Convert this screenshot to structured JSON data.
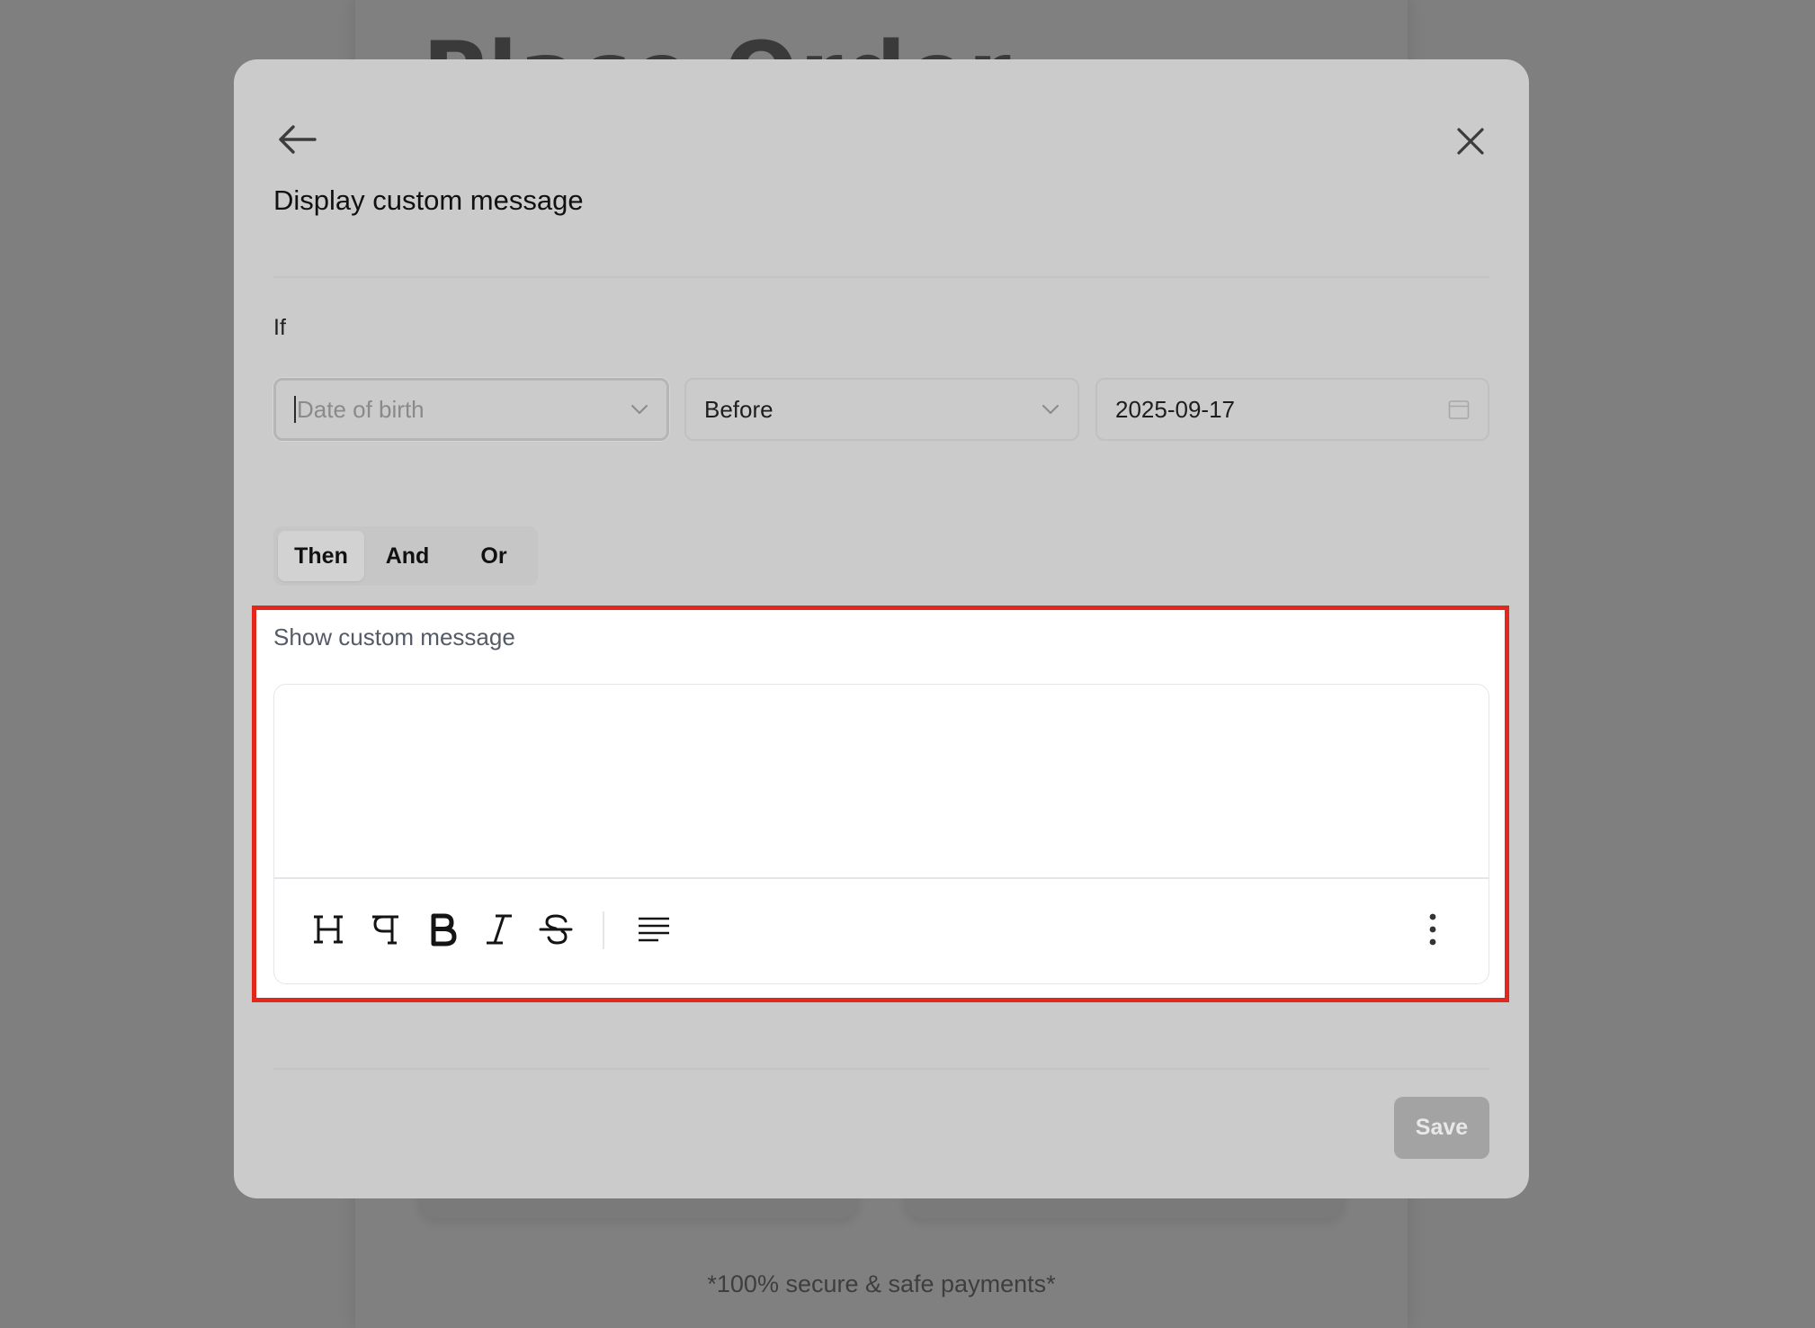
{
  "background_page": {
    "title": "Place Order",
    "footer": "*100% secure & safe payments*"
  },
  "modal": {
    "title": "Display custom message",
    "back_icon": "arrow-left-icon",
    "close_icon": "close-icon",
    "condition": {
      "label": "If",
      "field": {
        "placeholder": "Date of birth",
        "value": "",
        "icon": "chevron-down-icon"
      },
      "operator": {
        "value": "Before",
        "icon": "chevron-down-icon"
      },
      "date": {
        "value": "2025-09-17",
        "icon": "calendar-icon"
      }
    },
    "logic_tabs": [
      {
        "label": "Then",
        "active": true
      },
      {
        "label": "And",
        "active": false
      },
      {
        "label": "Or",
        "active": false
      }
    ],
    "action": {
      "label": "Show custom message",
      "editor_value": "",
      "toolbar": [
        "heading-icon",
        "paragraph-icon",
        "bold-icon",
        "italic-icon",
        "strikethrough-icon",
        "align-left-icon",
        "more-vertical-icon"
      ]
    },
    "save_label": "Save"
  },
  "colors": {
    "overlay": "#7f7f7f",
    "modal_bg": "#cbcbcb",
    "highlight_border": "#e2271d",
    "save_disabled": "#a3a3a3"
  }
}
